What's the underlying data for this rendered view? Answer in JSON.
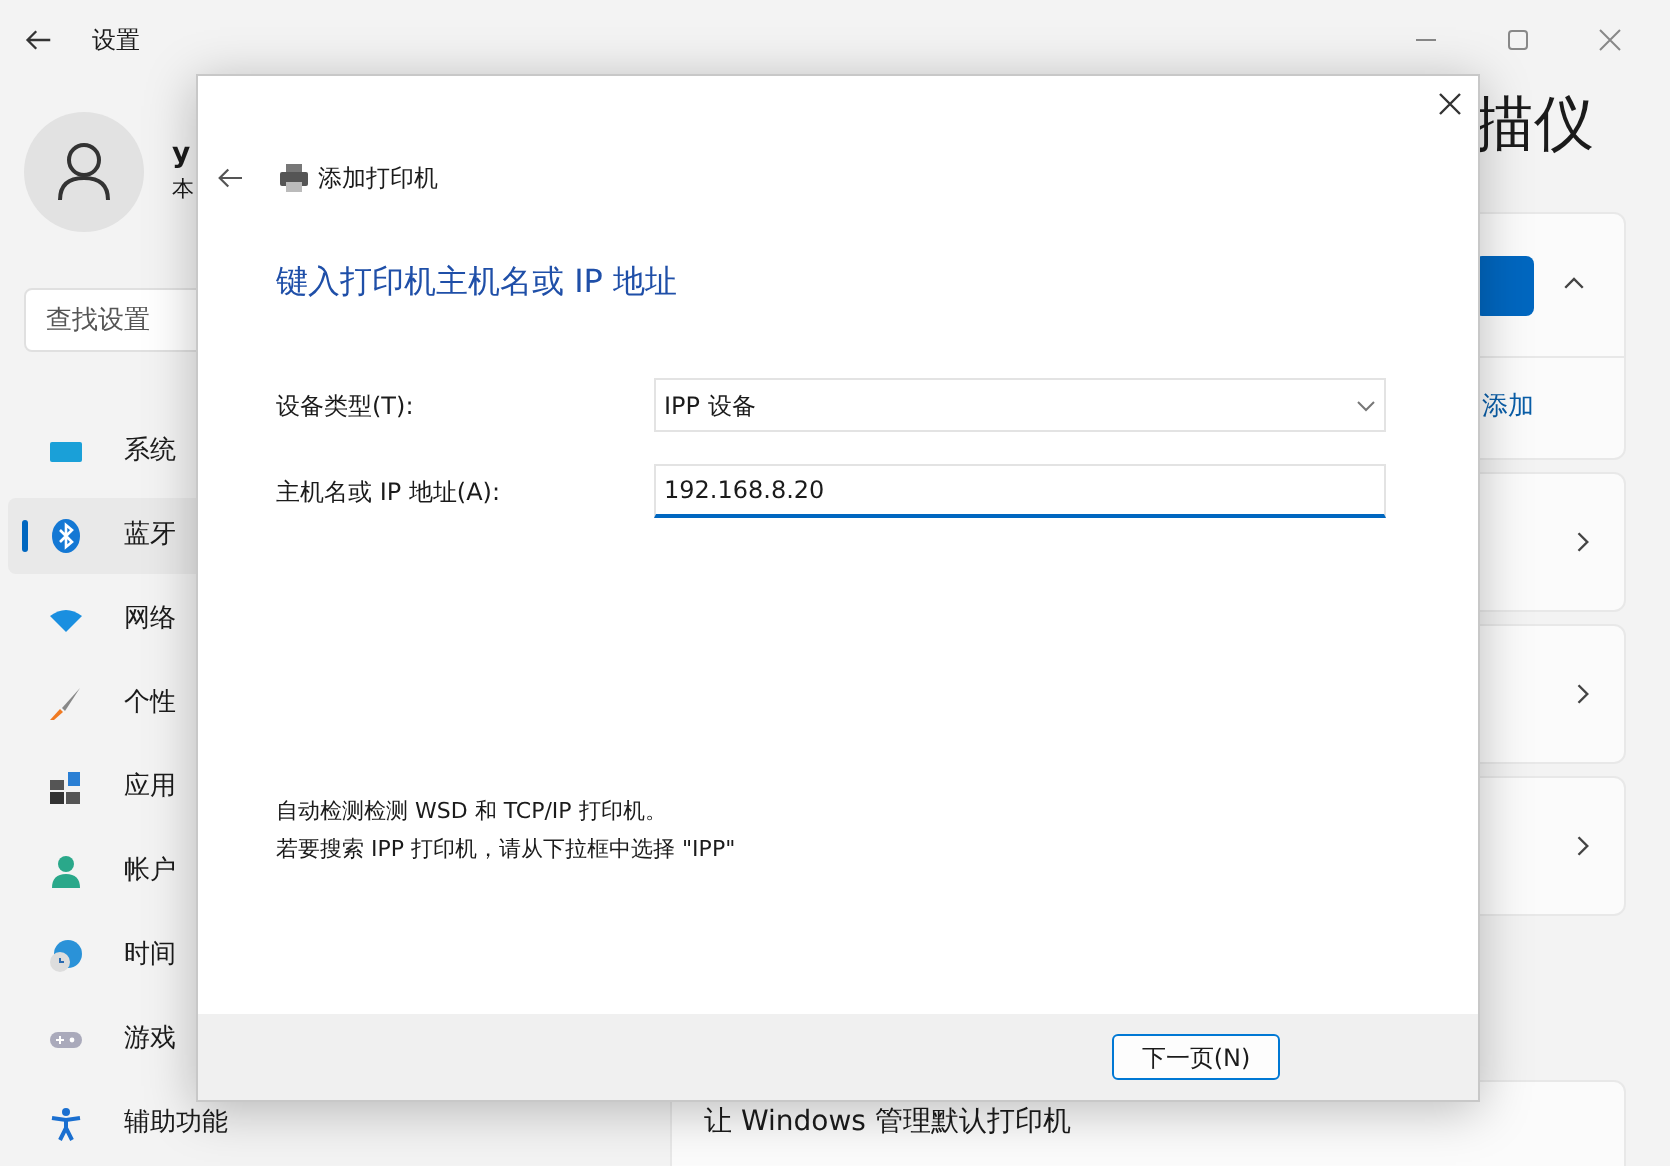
{
  "settings": {
    "title": "设置",
    "user": {
      "name": "y",
      "subtitle": "本"
    },
    "search": {
      "placeholder": "查找设置"
    },
    "nav": [
      {
        "label": "系统",
        "kind": "monitor",
        "selected": false
      },
      {
        "label": "蓝牙",
        "kind": "bluetooth",
        "selected": true
      },
      {
        "label": "网络",
        "kind": "wifi",
        "selected": false
      },
      {
        "label": "个性",
        "kind": "brush",
        "selected": false
      },
      {
        "label": "应用",
        "kind": "apps",
        "selected": false
      },
      {
        "label": "帐户",
        "kind": "person",
        "selected": false
      },
      {
        "label": "时间",
        "kind": "clock",
        "selected": false
      },
      {
        "label": "游戏",
        "kind": "gamepad",
        "selected": false
      },
      {
        "label": "辅助功能",
        "kind": "accessibility",
        "selected": false
      }
    ],
    "page_title": "描仪",
    "add_link": "添加",
    "bottom_setting": "让 Windows 管理默认打印机"
  },
  "dialog": {
    "title": "添加打印机",
    "heading": "键入打印机主机名或 IP 地址",
    "fields": [
      {
        "label": "设备类型(T):",
        "kind": "select",
        "value": "IPP 设备"
      },
      {
        "label": "主机名或 IP 地址(A):",
        "kind": "input",
        "value": "192.168.8.20"
      }
    ],
    "hints": [
      "自动检测检测 WSD 和 TCP/IP 打印机。",
      "若要搜索 IPP 打印机，请从下拉框中选择 \"IPP\""
    ],
    "next_button": "下一页(N)"
  }
}
